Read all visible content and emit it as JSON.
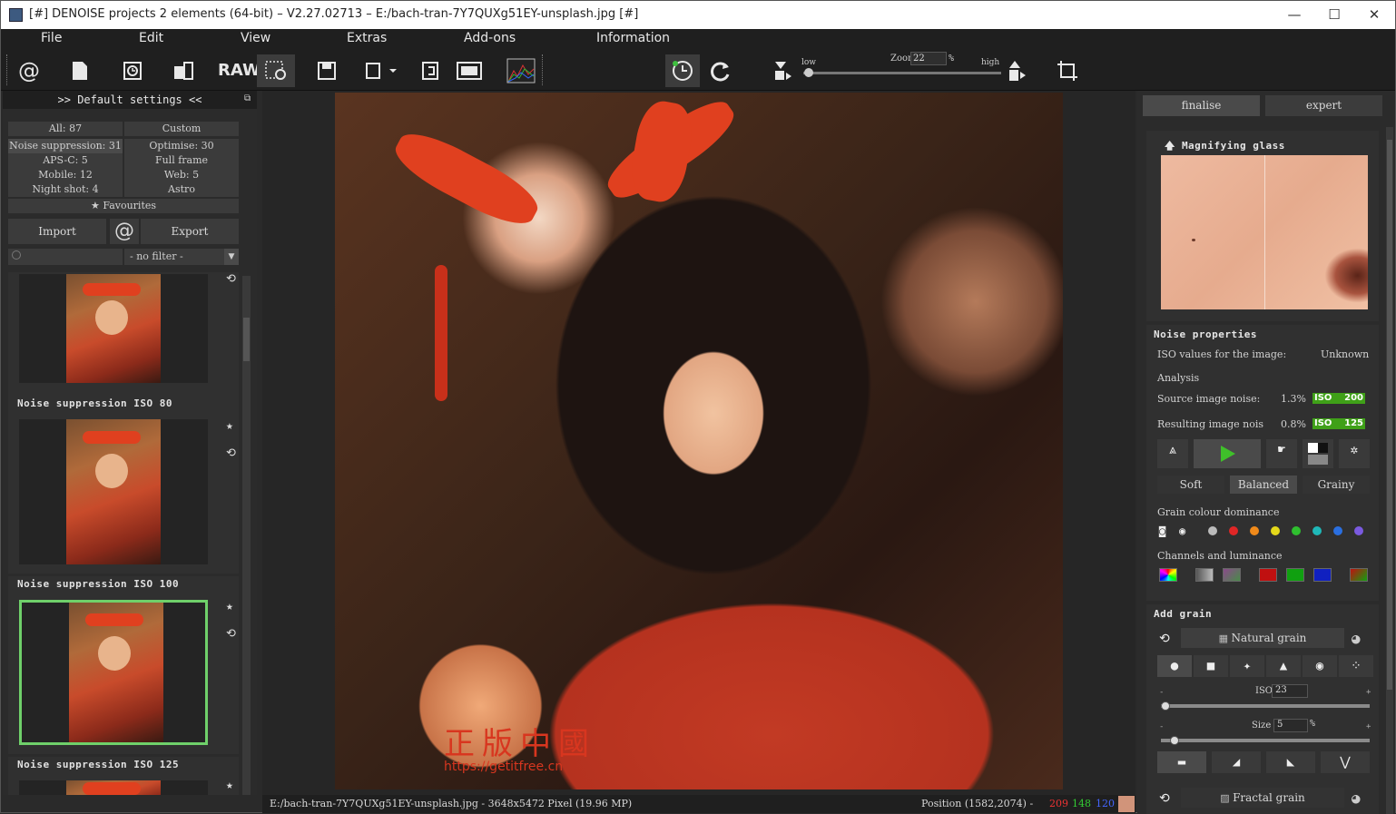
{
  "window": {
    "title": "[#] DENOISE projects 2 elements (64-bit) – V2.27.02713 – E:/bach-tran-7Y7QUXg51EY-unsplash.jpg [#]",
    "minimize": "—",
    "maximize": "☐",
    "close": "✕"
  },
  "menu": {
    "file": "File",
    "edit": "Edit",
    "view": "View",
    "extras": "Extras",
    "addons": "Add-ons",
    "information": "Information"
  },
  "toolbar": {
    "at_label": "@",
    "raw_label": "RAW",
    "zoom_low": "low",
    "zoom_label": "Zoom",
    "zoom_value": "22",
    "zoom_unit": "%",
    "zoom_high": "high"
  },
  "presets": {
    "title": ">> Default settings <<",
    "all": "All: 87",
    "custom": "Custom",
    "noise_suppression": "Noise suppression: 31",
    "optimise": "Optimise: 30",
    "apsc": "APS-C: 5",
    "full_frame": "Full frame",
    "mobile": "Mobile: 12",
    "web": "Web: 5",
    "night_shot": "Night shot: 4",
    "astro": "Astro",
    "favourites": "Favourites",
    "import": "Import",
    "export": "Export",
    "at": "@",
    "filter_value": "- no filter -"
  },
  "thumbnails": [
    {
      "label": "Noise suppression ISO 80"
    },
    {
      "label": "Noise suppression ISO 100"
    },
    {
      "label": "Noise suppression ISO 125"
    }
  ],
  "watermark": {
    "cn": "正版中國",
    "url": "https://getitfree.cn"
  },
  "status": {
    "path": "E:/bach-tran-7Y7QUXg51EY-unsplash.jpg - 3648x5472 Pixel (19.96 MP)",
    "position": "Position (1582,2074) -",
    "r": "209",
    "g": "148",
    "b": "120",
    "swatch_color": "#d1947a"
  },
  "right": {
    "tab_finalise": "finalise",
    "tab_expert": "expert",
    "magnifier_title": "Magnifying glass",
    "noise_properties": "Noise properties",
    "iso_values_label": "ISO values for the image:",
    "iso_values_value": "Unknown",
    "analysis": "Analysis",
    "source_noise_label": "Source image noise:",
    "source_noise_pct": "1.3%",
    "source_iso_tag": "ISO",
    "source_iso": "200",
    "result_noise_label": "Resulting image nois",
    "result_noise_pct": "0.8%",
    "result_iso_tag": "ISO",
    "result_iso": "125",
    "soft": "Soft",
    "balanced": "Balanced",
    "grainy": "Grainy",
    "grain_colour": "Grain colour dominance",
    "channels": "Channels and luminance",
    "add_grain": "Add grain",
    "natural_grain": "Natural grain",
    "iso_label": "ISO",
    "iso_value": "23",
    "size_label": "Size",
    "size_value": "5",
    "size_unit": "%",
    "fractal_grain": "Fractal grain",
    "minus": "-",
    "plus": "+"
  }
}
